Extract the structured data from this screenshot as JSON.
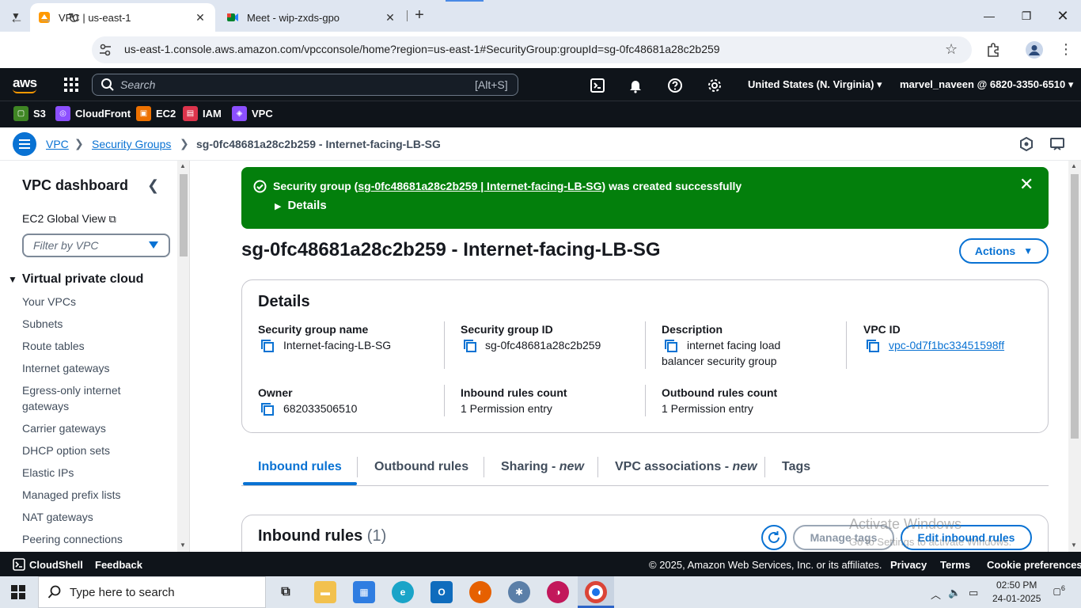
{
  "browser": {
    "tabs": [
      {
        "title": "VPC | us-east-1",
        "active": true
      },
      {
        "title": "Meet - wip-zxds-gpo",
        "active": false
      }
    ],
    "url": "us-east-1.console.aws.amazon.com/vpcconsole/home?region=us-east-1#SecurityGroup:groupId=sg-0fc48681a28c2b259"
  },
  "aws_nav": {
    "logo": "aws",
    "search_placeholder": "Search",
    "search_shortcut": "[Alt+S]",
    "region": "United States (N. Virginia) ▾",
    "account": "marvel_naveen @ 6820-3350-6510 ▾"
  },
  "favorites": [
    {
      "label": "S3",
      "icon": "s3-icon",
      "color": "#3f8624"
    },
    {
      "label": "CloudFront",
      "icon": "cloudfront-icon",
      "color": "#8c4fff"
    },
    {
      "label": "EC2",
      "icon": "ec2-icon",
      "color": "#ed7100"
    },
    {
      "label": "IAM",
      "icon": "iam-icon",
      "color": "#dd344c"
    },
    {
      "label": "VPC",
      "icon": "vpc-icon",
      "color": "#8c4fff"
    }
  ],
  "breadcrumb": {
    "items": [
      "VPC",
      "Security Groups"
    ],
    "current": "sg-0fc48681a28c2b259 - Internet-facing-LB-SG"
  },
  "sidebar": {
    "title": "VPC dashboard",
    "global_view": "EC2 Global View",
    "filter_placeholder": "Filter by VPC",
    "section": "Virtual private cloud",
    "items": [
      "Your VPCs",
      "Subnets",
      "Route tables",
      "Internet gateways",
      "Egress-only internet gateways",
      "Carrier gateways",
      "DHCP option sets",
      "Elastic IPs",
      "Managed prefix lists",
      "NAT gateways",
      "Peering connections"
    ]
  },
  "flash": {
    "prefix": "Security group (",
    "link": "sg-0fc48681a28c2b259 | Internet-facing-LB-SG",
    "suffix": ") was created successfully",
    "details": "Details",
    "color": "#037f0c"
  },
  "page": {
    "title": "sg-0fc48681a28c2b259 - Internet-facing-LB-SG",
    "actions": "Actions"
  },
  "details": {
    "heading": "Details",
    "fields": {
      "sg_name": {
        "label": "Security group name",
        "value": "Internet-facing-LB-SG"
      },
      "sg_id": {
        "label": "Security group ID",
        "value": "sg-0fc48681a28c2b259"
      },
      "description": {
        "label": "Description",
        "value": "internet facing load balancer security group"
      },
      "vpc_id": {
        "label": "VPC ID",
        "value": "vpc-0d7f1bc33451598ff"
      },
      "owner": {
        "label": "Owner",
        "value": "682033506510"
      },
      "inbound_count": {
        "label": "Inbound rules count",
        "value": "1 Permission entry"
      },
      "outbound_count": {
        "label": "Outbound rules count",
        "value": "1 Permission entry"
      }
    }
  },
  "tabs": {
    "inbound": "Inbound rules",
    "outbound": "Outbound rules",
    "sharing": "Sharing - ",
    "sharing_new": "new",
    "vpc_assoc": "VPC associations - ",
    "vpc_assoc_new": "new",
    "tags": "Tags"
  },
  "inbound_panel": {
    "title": "Inbound rules",
    "count": "(1)",
    "manage_tags": "Manage tags",
    "edit": "Edit inbound rules"
  },
  "watermark": {
    "line1": "Activate Windows",
    "line2": "Go to Settings to activate Windows."
  },
  "footer": {
    "cloudshell": "CloudShell",
    "feedback": "Feedback",
    "copyright": "© 2025, Amazon Web Services, Inc. or its affiliates.",
    "privacy": "Privacy",
    "terms": "Terms",
    "cookies": "Cookie preferences"
  },
  "taskbar": {
    "search": "Type here to search",
    "time": "02:50 PM",
    "date": "24-01-2025",
    "notifications": "6"
  },
  "colors": {
    "aws_dark": "#0f141a",
    "link_blue": "#0972d3",
    "aws_orange": "#ff9900"
  }
}
